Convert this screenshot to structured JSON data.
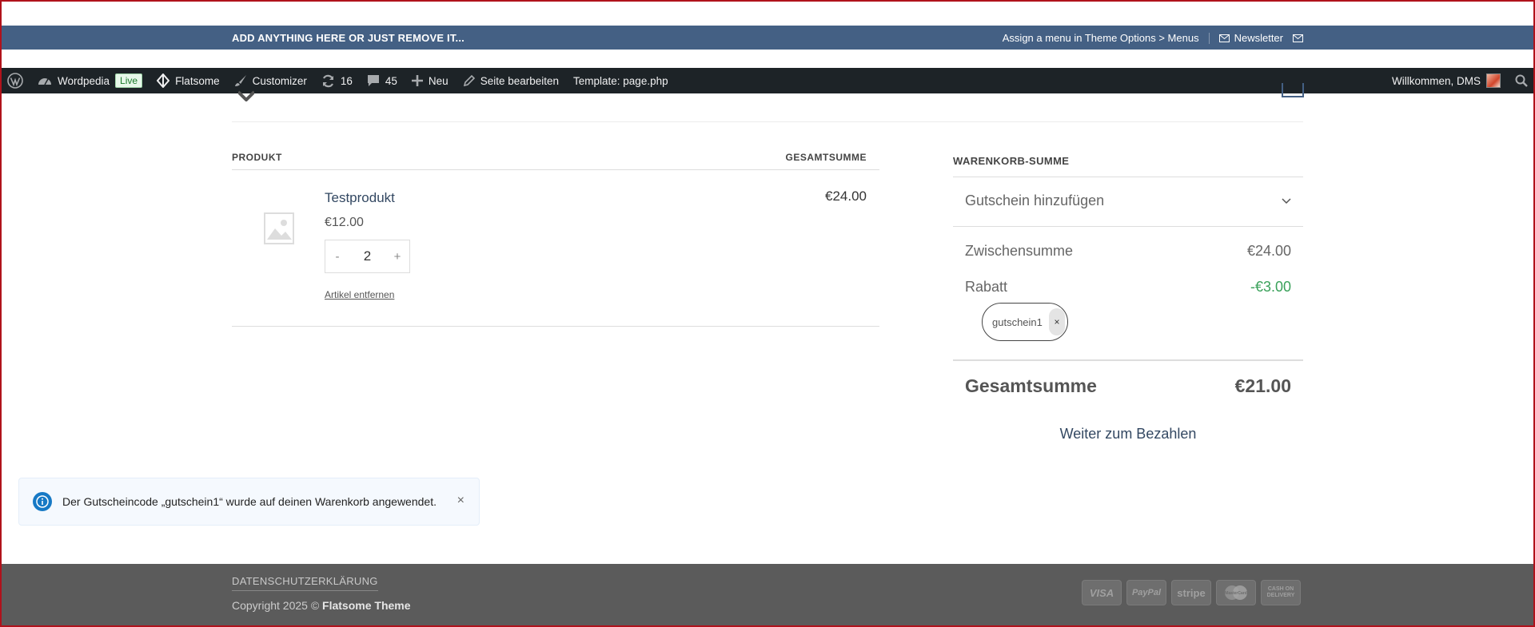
{
  "topbar": {
    "left_text": "ADD ANYTHING HERE OR JUST REMOVE IT...",
    "menu_hint": "Assign a menu in Theme Options > Menus",
    "newsletter": "Newsletter"
  },
  "adminbar": {
    "site_name": "Wordpedia",
    "live_badge": "Live",
    "theme": "Flatsome",
    "customizer": "Customizer",
    "updates_count": "16",
    "comments_count": "45",
    "new_label": "Neu",
    "edit_page": "Seite bearbeiten",
    "template": "Template: page.php",
    "welcome": "Willkommen, DMS"
  },
  "cart": {
    "col_product": "PRODUKT",
    "col_total": "GESAMTSUMME",
    "items": [
      {
        "name": "Testprodukt",
        "price": "€12.00",
        "qty_minus": "-",
        "quantity": "2",
        "qty_plus": "+",
        "remove": "Artikel entfernen",
        "subtotal": "€24.00"
      }
    ]
  },
  "totals": {
    "heading": "WARENKORB-SUMME",
    "coupon_toggle": "Gutschein hinzufügen",
    "subtotal_label": "Zwischensumme",
    "subtotal_value": "€24.00",
    "discount_label": "Rabatt",
    "discount_value": "-€3.00",
    "coupon_code": "gutschein1",
    "coupon_remove": "×",
    "grand_label": "Gesamtsumme",
    "grand_value": "€21.00",
    "checkout": "Weiter zum Bezahlen"
  },
  "notice": {
    "message": "Der Gutscheincode „gutschein1“ wurde auf deinen Warenkorb angewendet.",
    "close": "×"
  },
  "footer": {
    "privacy": "DATENSCHUTZERKLÄRUNG",
    "copyright_prefix": "Copyright 2025 © ",
    "copyright_brand": "Flatsome Theme",
    "payments": [
      "VISA",
      "PayPal",
      "stripe",
      "MasterCard",
      "CASH ON DELIVERY"
    ]
  },
  "colors": {
    "topbar_bg": "#446084",
    "adminbar_bg": "#1d2327",
    "link": "#334862",
    "discount": "#3aa15a",
    "info_icon": "#1779c5",
    "footer_bg": "#5b5b5b"
  }
}
